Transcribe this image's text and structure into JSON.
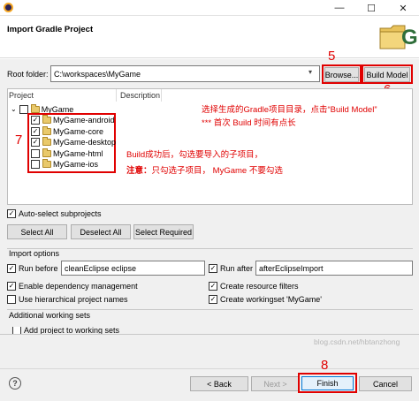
{
  "window": {
    "title": "Import Gradle Project",
    "controls": {
      "minimize": "—",
      "maximize": "☐",
      "close": "✕"
    }
  },
  "root": {
    "label": "Root folder:",
    "value": "C:\\workspaces\\MyGame",
    "browse_label": "Browse...",
    "build_model_label": "Build Model"
  },
  "table": {
    "col_project": "Project",
    "col_description": "Description",
    "root_item": "MyGame",
    "items": [
      {
        "label": "MyGame-android",
        "checked": true
      },
      {
        "label": "MyGame-core",
        "checked": true
      },
      {
        "label": "MyGame-desktop",
        "checked": true
      },
      {
        "label": "MyGame-html",
        "checked": false
      },
      {
        "label": "MyGame-ios",
        "checked": false
      }
    ]
  },
  "annotations": {
    "num5": "5",
    "num6": "6",
    "num7": "7",
    "num8": "8",
    "note1": "选择生成的Gradle项目目录，点击“Build Model”",
    "note2": "*** 首次 Build 时间有点长",
    "note3": "Build成功后，勾选要导入的子项目，",
    "note4_bold": "注意：",
    "note4_rest": "只勾选子项目， MyGame 不要勾选"
  },
  "auto_select": {
    "label": "Auto-select subprojects",
    "checked": true
  },
  "selection_buttons": {
    "select_all": "Select All",
    "deselect_all": "Deselect All",
    "select_required": "Select Required"
  },
  "import_options": {
    "group_label": "Import options",
    "run_before_label": "Run before",
    "run_before_value": "cleanEclipse eclipse",
    "run_after_label": "Run after",
    "run_after_value": "afterEclipseImport",
    "enable_dep_mgmt": "Enable dependency management",
    "create_resource_filters": "Create resource filters",
    "use_hier_names": "Use hierarchical project names",
    "create_workingset": "Create workingset 'MyGame'"
  },
  "additional": {
    "group_label": "Additional working sets",
    "add_to_ws": "Add project to working sets"
  },
  "watermark": "blog.csdn.net/hbtanzhong",
  "footer": {
    "help": "?",
    "back": "< Back",
    "next": "Next >",
    "finish": "Finish",
    "cancel": "Cancel"
  }
}
